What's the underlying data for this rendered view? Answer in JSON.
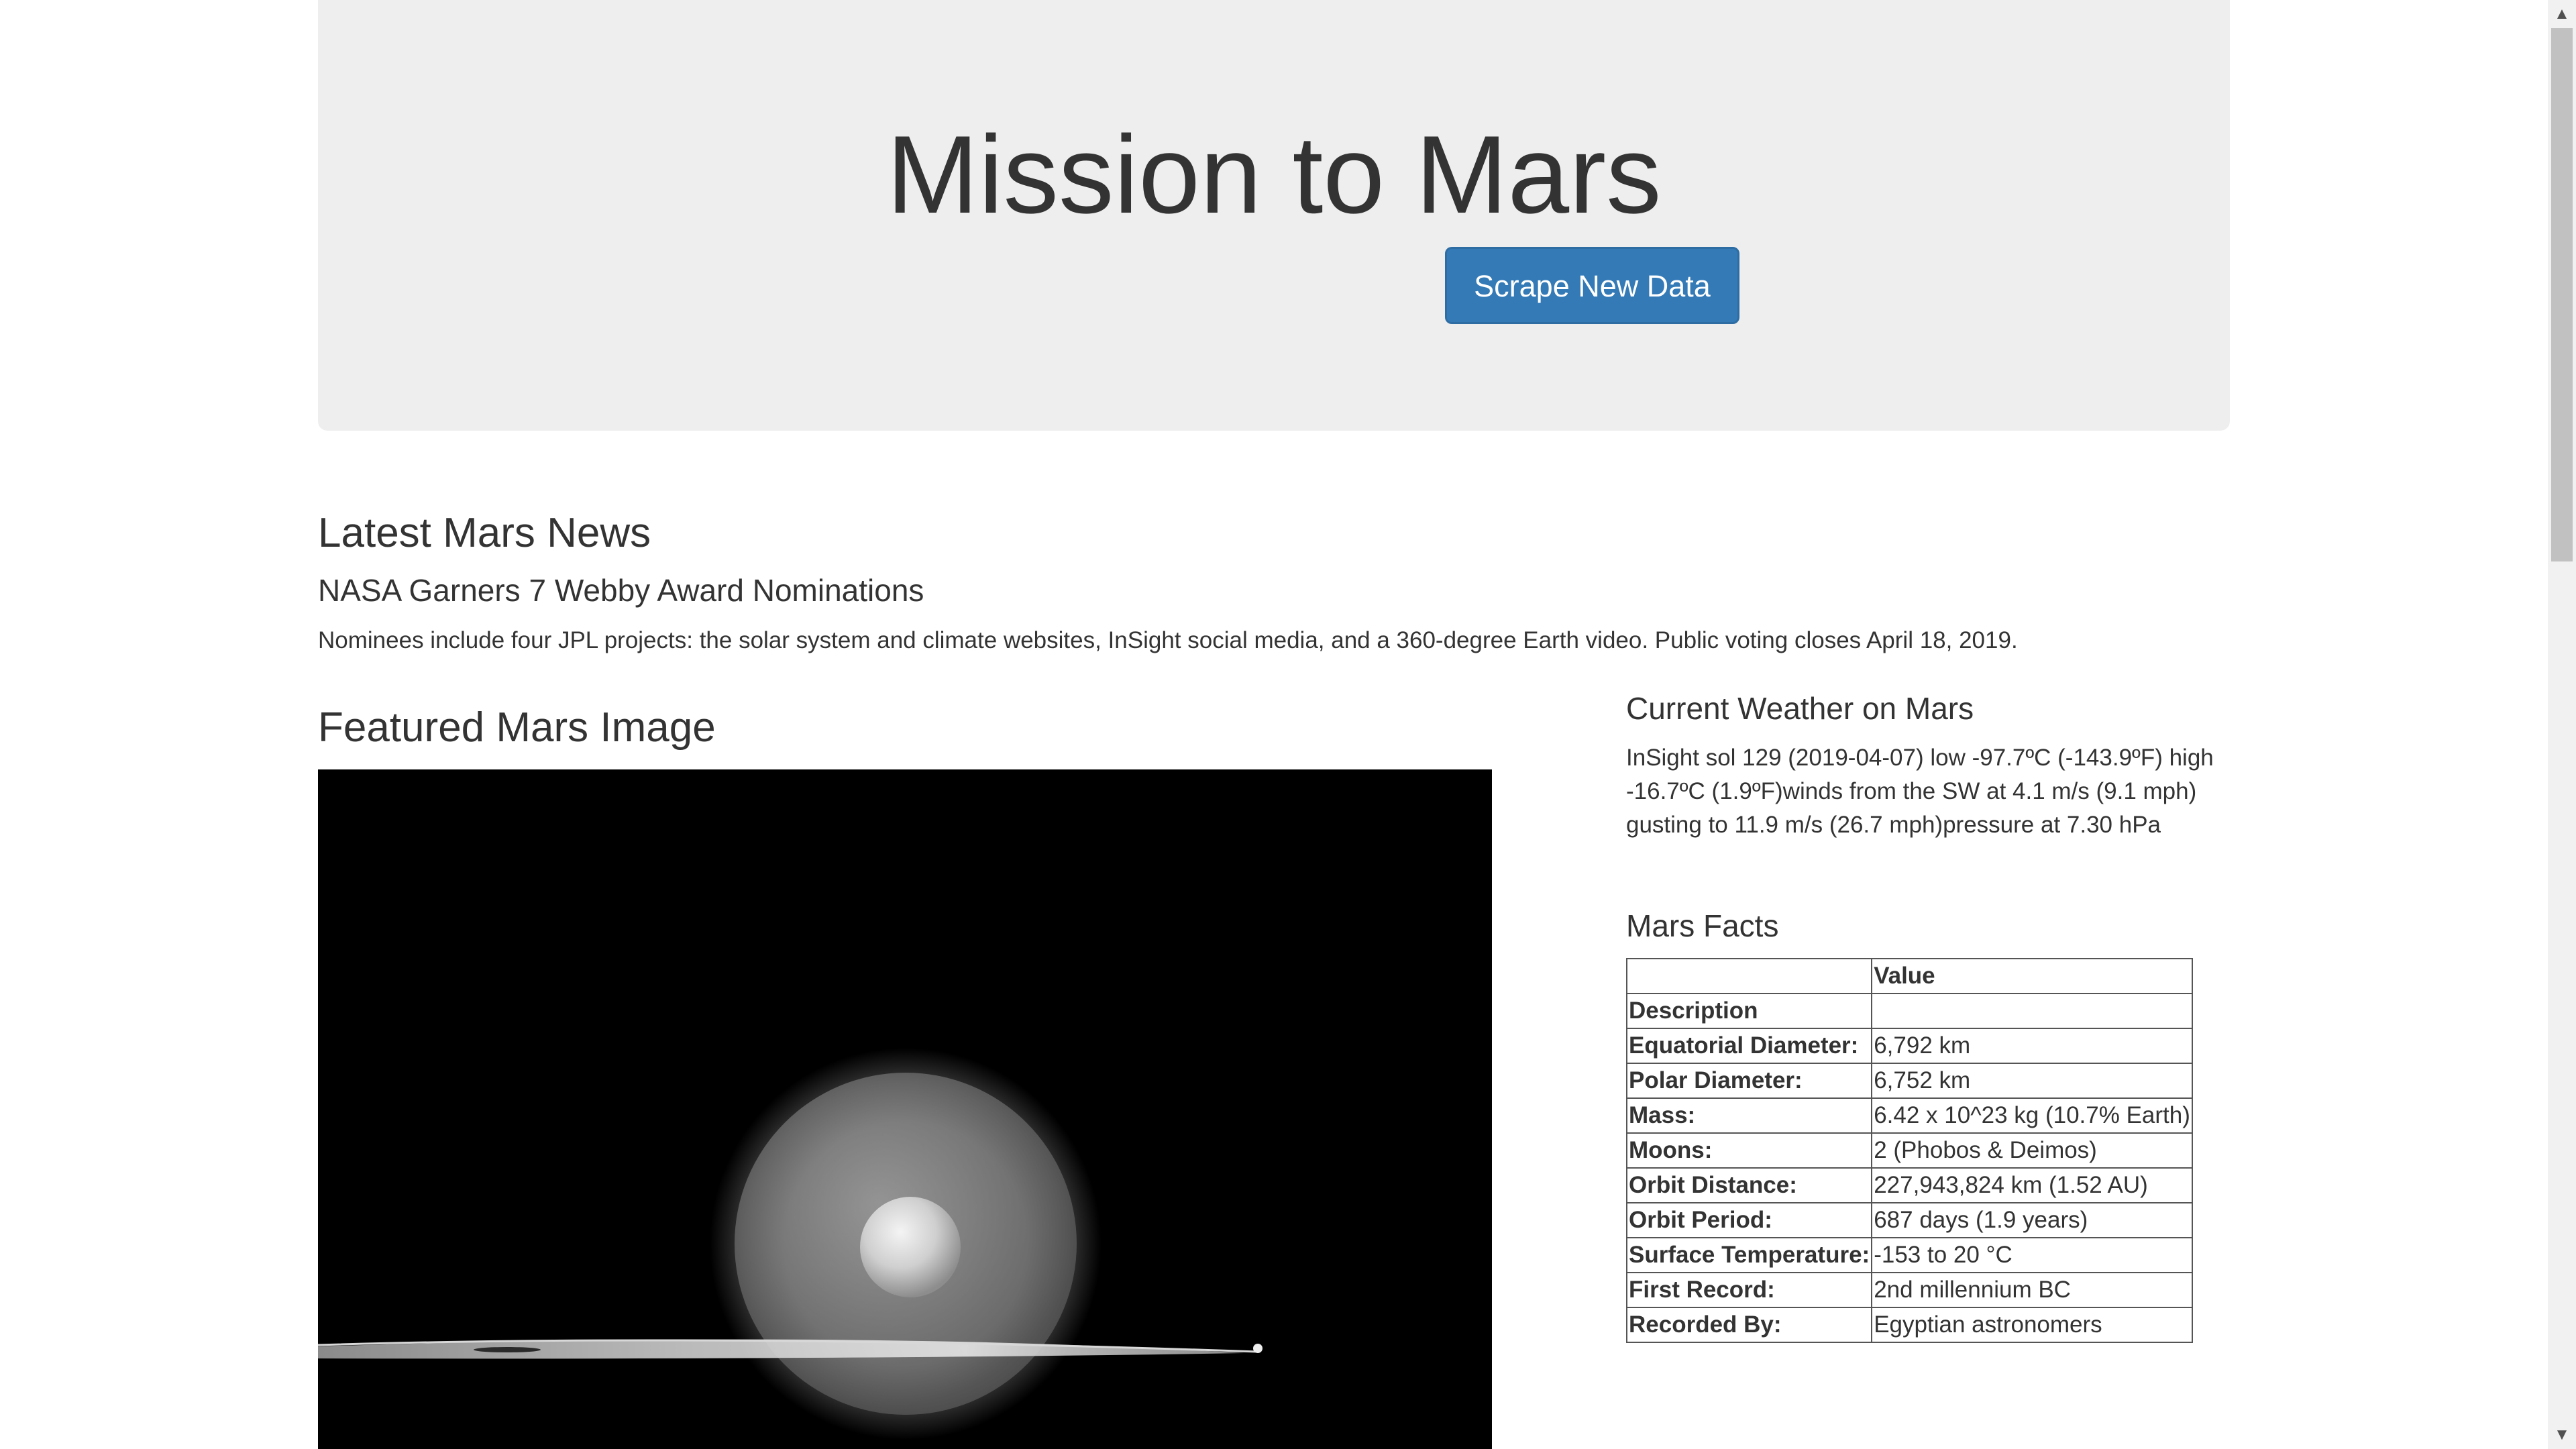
{
  "header": {
    "title": "Mission to Mars",
    "scrape_button": "Scrape New Data"
  },
  "news": {
    "section_title": "Latest Mars News",
    "headline": "NASA Garners 7 Webby Award Nominations",
    "teaser": "Nominees include four JPL projects: the solar system and climate websites, InSight social media, and a 360-degree Earth video. Public voting closes April 18, 2019."
  },
  "featured_image": {
    "section_title": "Featured Mars Image"
  },
  "weather": {
    "section_title": "Current Weather on Mars",
    "text": "InSight sol 129 (2019-04-07) low -97.7ºC (-143.9ºF) high -16.7ºC (1.9ºF)winds from the SW at 4.1 m/s (9.1 mph) gusting to 11.9 m/s (26.7 mph)pressure at 7.30 hPa"
  },
  "facts": {
    "section_title": "Mars Facts",
    "header_blank": "",
    "header_value": "Value",
    "index_label": "Description",
    "rows": [
      {
        "label": "Equatorial Diameter:",
        "value": "6,792 km"
      },
      {
        "label": "Polar Diameter:",
        "value": "6,752 km"
      },
      {
        "label": "Mass:",
        "value": "6.42 x 10^23 kg (10.7% Earth)"
      },
      {
        "label": "Moons:",
        "value": "2 (Phobos & Deimos)"
      },
      {
        "label": "Orbit Distance:",
        "value": "227,943,824 km (1.52 AU)"
      },
      {
        "label": "Orbit Period:",
        "value": "687 days (1.9 years)"
      },
      {
        "label": "Surface Temperature:",
        "value": "-153 to 20 °C"
      },
      {
        "label": "First Record:",
        "value": "2nd millennium BC"
      },
      {
        "label": "Recorded By:",
        "value": "Egyptian astronomers"
      }
    ]
  },
  "scrollbar": {
    "up_icon": "▲",
    "down_icon": "▼"
  }
}
